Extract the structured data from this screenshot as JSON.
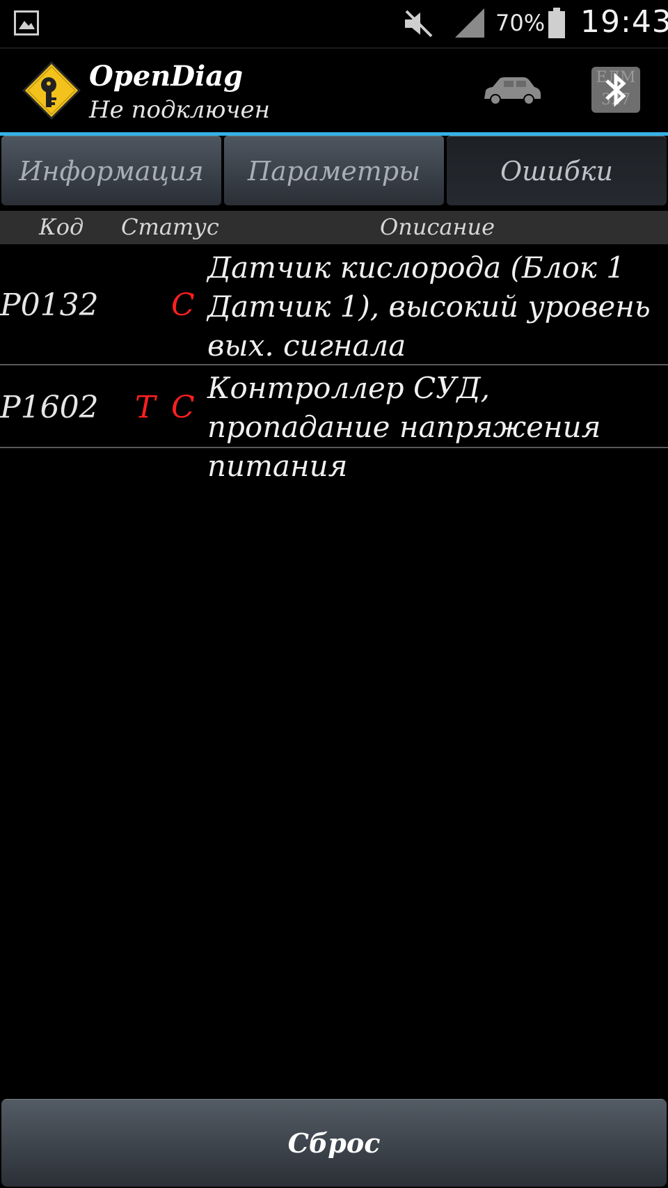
{
  "status_bar": {
    "battery_percent": "70%",
    "time": "19:43",
    "icons": [
      "gallery-notification-icon",
      "mute-icon",
      "signal-icon",
      "battery-icon"
    ]
  },
  "action_bar": {
    "title": "OpenDiag",
    "subtitle": "Не подключен",
    "icons": [
      "app-logo-icon",
      "car-icon",
      "bluetooth-icon"
    ],
    "bluetooth_bg_text": "ЕЛМ 327"
  },
  "tabs": [
    {
      "label": "Информация",
      "active": false
    },
    {
      "label": "Параметры",
      "active": false
    },
    {
      "label": "Ошибки",
      "active": true
    }
  ],
  "table": {
    "headers": {
      "code": "Код",
      "status": "Статус",
      "description": "Описание"
    },
    "rows": [
      {
        "code": "P0132",
        "status_t": "",
        "status_c": "C",
        "description": "Датчик кислорода (Блок 1 Датчик 1), высокий уровень вых. сигнала"
      },
      {
        "code": "P1602",
        "status_t": "T",
        "status_c": "C",
        "description": "Контроллер СУД, пропадание напряжения питания"
      }
    ]
  },
  "footer": {
    "reset_label": "Сброс"
  },
  "colors": {
    "accent": "#35b2e6",
    "status_red": "#ff2020",
    "background": "#000000"
  }
}
